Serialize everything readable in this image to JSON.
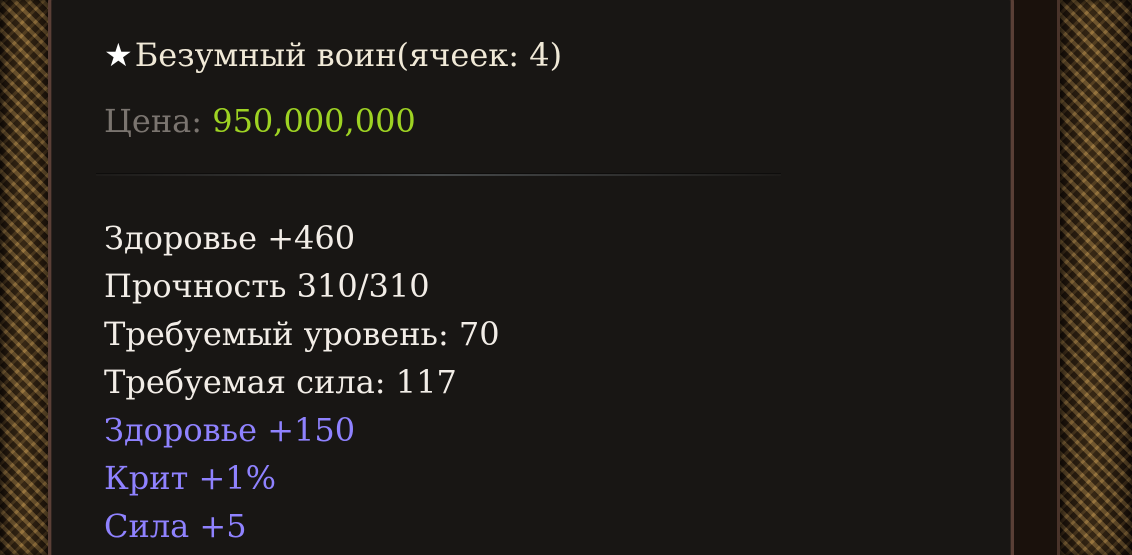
{
  "item": {
    "icon": "star-icon",
    "star_symbol": "★",
    "name": "Безумный воин(ячеек: 4)",
    "price_label": "Цена: ",
    "price_value": "950,000,000"
  },
  "base_stats": [
    {
      "text": "Здоровье +460"
    },
    {
      "text": "Прочность 310/310"
    },
    {
      "text": "Требуемый уровень: 70"
    },
    {
      "text": "Требуемая сила: 117"
    }
  ],
  "bonus_stats": [
    {
      "text": "Здоровье +150"
    },
    {
      "text": "Крит +1%"
    },
    {
      "text": "Сила +5"
    }
  ],
  "colors": {
    "title": "#f0e9d7",
    "price_label": "#7a746f",
    "price_value": "#9ed323",
    "base_stat": "#f2ede7",
    "bonus_stat": "#8f82ff",
    "frame_border": "#5a3f36"
  }
}
